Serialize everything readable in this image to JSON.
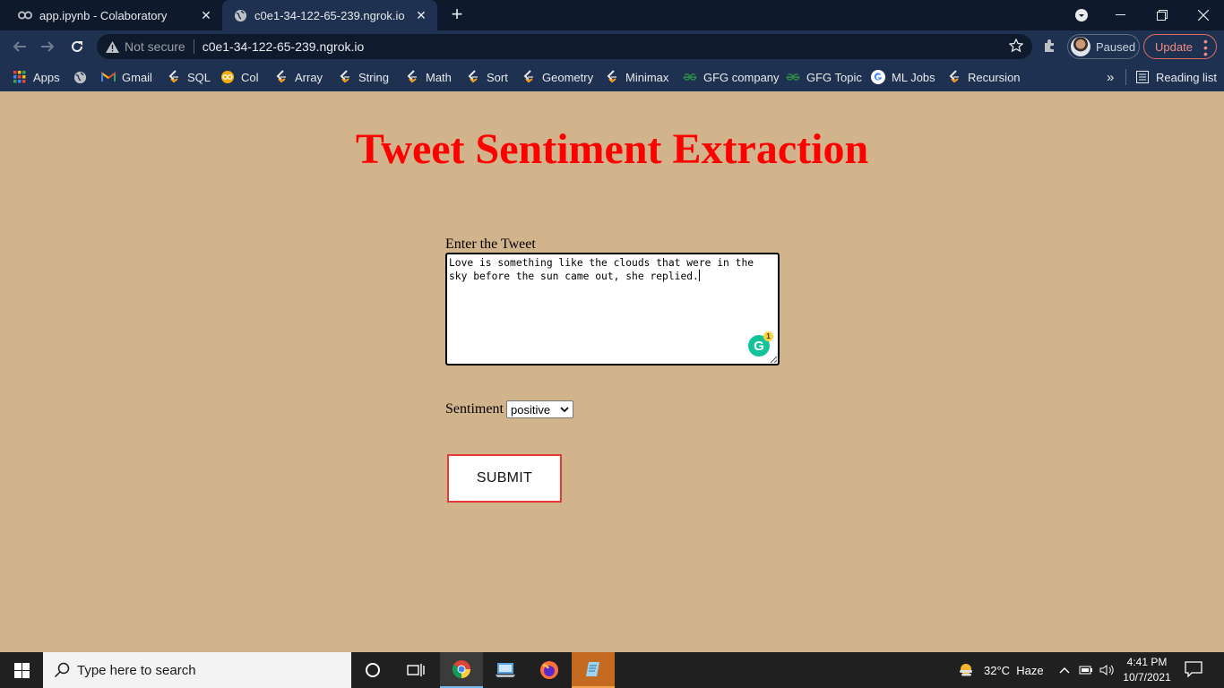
{
  "browser": {
    "tabs": [
      {
        "title": "app.ipynb - Colaboratory",
        "icon": "colab-icon",
        "active": false
      },
      {
        "title": "c0e1-34-122-65-239.ngrok.io",
        "icon": "globe-icon",
        "active": true
      }
    ],
    "security_label": "Not secure",
    "url": "c0e1-34-122-65-239.ngrok.io",
    "profile_label": "Paused",
    "update_label": "Update",
    "bookmarks": [
      {
        "label": "Apps",
        "icon": "apps-grid-icon"
      },
      {
        "label": "",
        "icon": "globe-icon"
      },
      {
        "label": "Gmail",
        "icon": "gmail-icon"
      },
      {
        "label": "SQL",
        "icon": "leetcode-icon"
      },
      {
        "label": "Col",
        "icon": "colab-icon"
      },
      {
        "label": "Array",
        "icon": "leetcode-icon"
      },
      {
        "label": "String",
        "icon": "leetcode-icon"
      },
      {
        "label": "Math",
        "icon": "leetcode-icon"
      },
      {
        "label": "Sort",
        "icon": "leetcode-icon"
      },
      {
        "label": "Geometry",
        "icon": "leetcode-icon"
      },
      {
        "label": "Minimax",
        "icon": "leetcode-icon"
      },
      {
        "label": "GFG company",
        "icon": "gfg-icon"
      },
      {
        "label": "GFG Topic",
        "icon": "gfg-icon"
      },
      {
        "label": "ML Jobs",
        "icon": "google-icon"
      },
      {
        "label": "Recursion",
        "icon": "leetcode-icon"
      }
    ],
    "overflow_label": "»",
    "reading_list_label": "Reading list"
  },
  "page": {
    "title": "Tweet Sentiment Extraction",
    "tweet_label": "Enter the Tweet",
    "tweet_value": "Love is something like the clouds that were in the sky before the sun came out, she replied.",
    "grammarly_count": "1",
    "sentiment_label": "Sentiment",
    "sentiment_value": "positive",
    "submit_label": "SUBMIT",
    "colors": {
      "background": "#d2b48c",
      "title": "#ff0000",
      "submit_border": "#e53935"
    }
  },
  "taskbar": {
    "search_placeholder": "Type here to search",
    "weather": "32°C  Haze",
    "time": "4:41 PM",
    "date": "10/7/2021",
    "apps": [
      "cortana-icon",
      "task-view-icon",
      "chrome-icon",
      "file-manager-icon",
      "firefox-icon",
      "notepad-icon"
    ]
  }
}
